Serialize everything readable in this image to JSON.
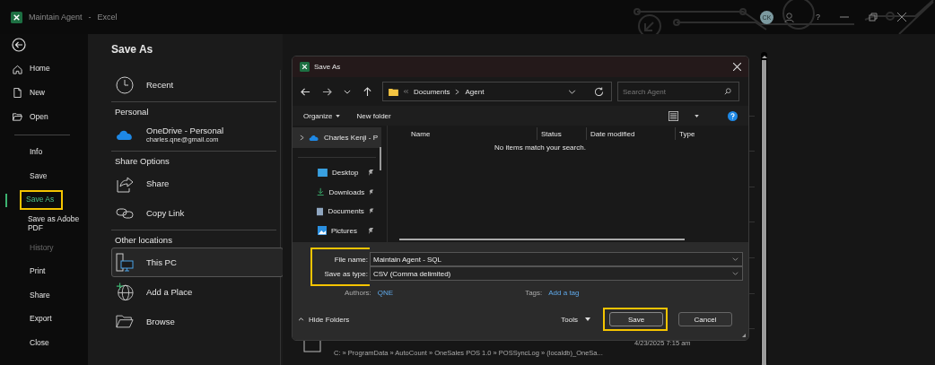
{
  "title_bar": {
    "document": "Maintain Agent",
    "separator": "-",
    "app": "Excel",
    "avatar_initials": "CK",
    "help": "?"
  },
  "nav": {
    "items": [
      {
        "label": "Home",
        "selected": false,
        "disabled": false,
        "highlighted": false
      },
      {
        "label": "New",
        "selected": false,
        "disabled": false,
        "highlighted": false
      },
      {
        "label": "Open",
        "selected": false,
        "disabled": false,
        "highlighted": false
      },
      {
        "label": "Info",
        "selected": false,
        "disabled": false,
        "highlighted": false
      },
      {
        "label": "Save",
        "selected": false,
        "disabled": false,
        "highlighted": false
      },
      {
        "label": "Save As",
        "selected": true,
        "disabled": false,
        "highlighted": true
      },
      {
        "label": "Save as Adobe PDF",
        "selected": false,
        "disabled": false,
        "highlighted": false
      },
      {
        "label": "History",
        "selected": false,
        "disabled": true,
        "highlighted": false
      },
      {
        "label": "Print",
        "selected": false,
        "disabled": false,
        "highlighted": false
      },
      {
        "label": "Share",
        "selected": false,
        "disabled": false,
        "highlighted": false
      },
      {
        "label": "Export",
        "selected": false,
        "disabled": false,
        "highlighted": false
      },
      {
        "label": "Close",
        "selected": false,
        "disabled": false,
        "highlighted": false
      }
    ]
  },
  "locations": {
    "title": "Save As",
    "items": [
      {
        "kind": "location",
        "label": "Recent",
        "selected": false
      },
      {
        "kind": "heading",
        "label": "Personal"
      },
      {
        "kind": "location",
        "label": "OneDrive - Personal",
        "sublabel": "charles.qne@gmail.com",
        "selected": false
      },
      {
        "kind": "heading",
        "label": "Share Options"
      },
      {
        "kind": "location",
        "label": "Share",
        "selected": false
      },
      {
        "kind": "location",
        "label": "Copy Link",
        "selected": false
      },
      {
        "kind": "heading",
        "label": "Other locations"
      },
      {
        "kind": "location",
        "label": "This PC",
        "selected": true
      },
      {
        "kind": "location",
        "label": "Add a Place",
        "selected": false
      },
      {
        "kind": "location",
        "label": "Browse",
        "selected": false
      }
    ]
  },
  "recent_file": {
    "path": "C: » ProgramData » AutoCount » OneSales POS 1.0 » POSSyncLog » (localdb)_OneSa...",
    "date": "4/23/2025 7:15 am"
  },
  "dialog": {
    "title": "Save As",
    "breadcrumb": [
      "Documents",
      "Agent"
    ],
    "search": {
      "placeholder": "Search Agent"
    },
    "toolbar": {
      "organize": "Organize",
      "new_folder": "New folder"
    },
    "tree": [
      {
        "label": "Charles Kenji - P",
        "selected": true,
        "pinned": false
      },
      {
        "label": "Desktop",
        "selected": false,
        "pinned": true
      },
      {
        "label": "Downloads",
        "selected": false,
        "pinned": true
      },
      {
        "label": "Documents",
        "selected": false,
        "pinned": true
      },
      {
        "label": "Pictures",
        "selected": false,
        "pinned": true
      }
    ],
    "columns": [
      "Name",
      "Status",
      "Date modified",
      "Type"
    ],
    "empty_message": "No items match your search.",
    "fields": [
      {
        "label": "File name:",
        "value": "Maintain Agent - SQL"
      },
      {
        "label": "Save as type:",
        "value": "CSV (Comma delimited)"
      }
    ],
    "fields_highlighted": true,
    "authors": {
      "label": "Authors:",
      "value": "QNE"
    },
    "tags": {
      "label": "Tags:",
      "value": "Add a tag"
    },
    "hide_folders": "Hide Folders",
    "tools": "Tools",
    "buttons": [
      {
        "label": "Save",
        "primary": true,
        "highlighted": true
      },
      {
        "label": "Cancel",
        "primary": false,
        "highlighted": false
      }
    ]
  }
}
